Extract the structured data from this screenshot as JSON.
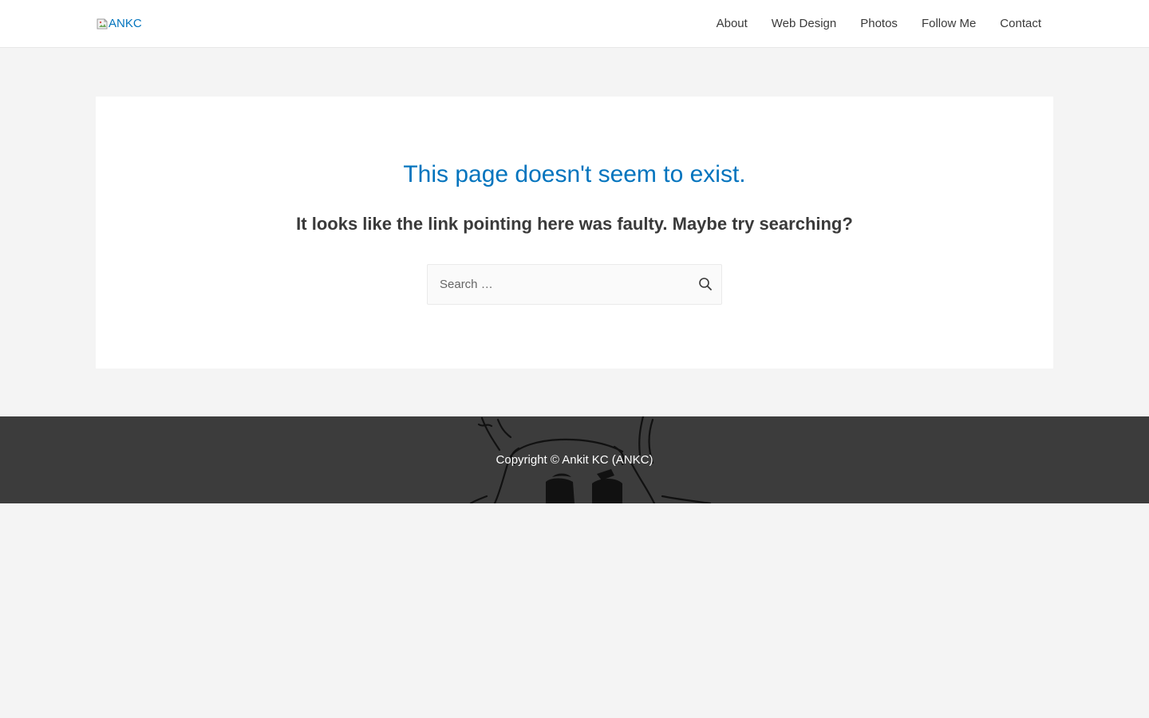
{
  "header": {
    "logo_alt": "ANKC",
    "nav": [
      {
        "label": "About"
      },
      {
        "label": "Web Design"
      },
      {
        "label": "Photos"
      },
      {
        "label": "Follow Me"
      },
      {
        "label": "Contact"
      }
    ]
  },
  "main": {
    "title": "This page doesn't seem to exist.",
    "subtitle": "It looks like the link pointing here was faulty. Maybe try searching?",
    "search": {
      "placeholder": "Search …",
      "value": "",
      "submit_icon": "search-icon"
    }
  },
  "footer": {
    "copyright": "Copyright © Ankit KC (ANKC)"
  },
  "colors": {
    "accent": "#0274be",
    "text": "#3a3a3a",
    "page_bg": "#f4f4f4",
    "footer_bg": "#3c3c3c"
  }
}
